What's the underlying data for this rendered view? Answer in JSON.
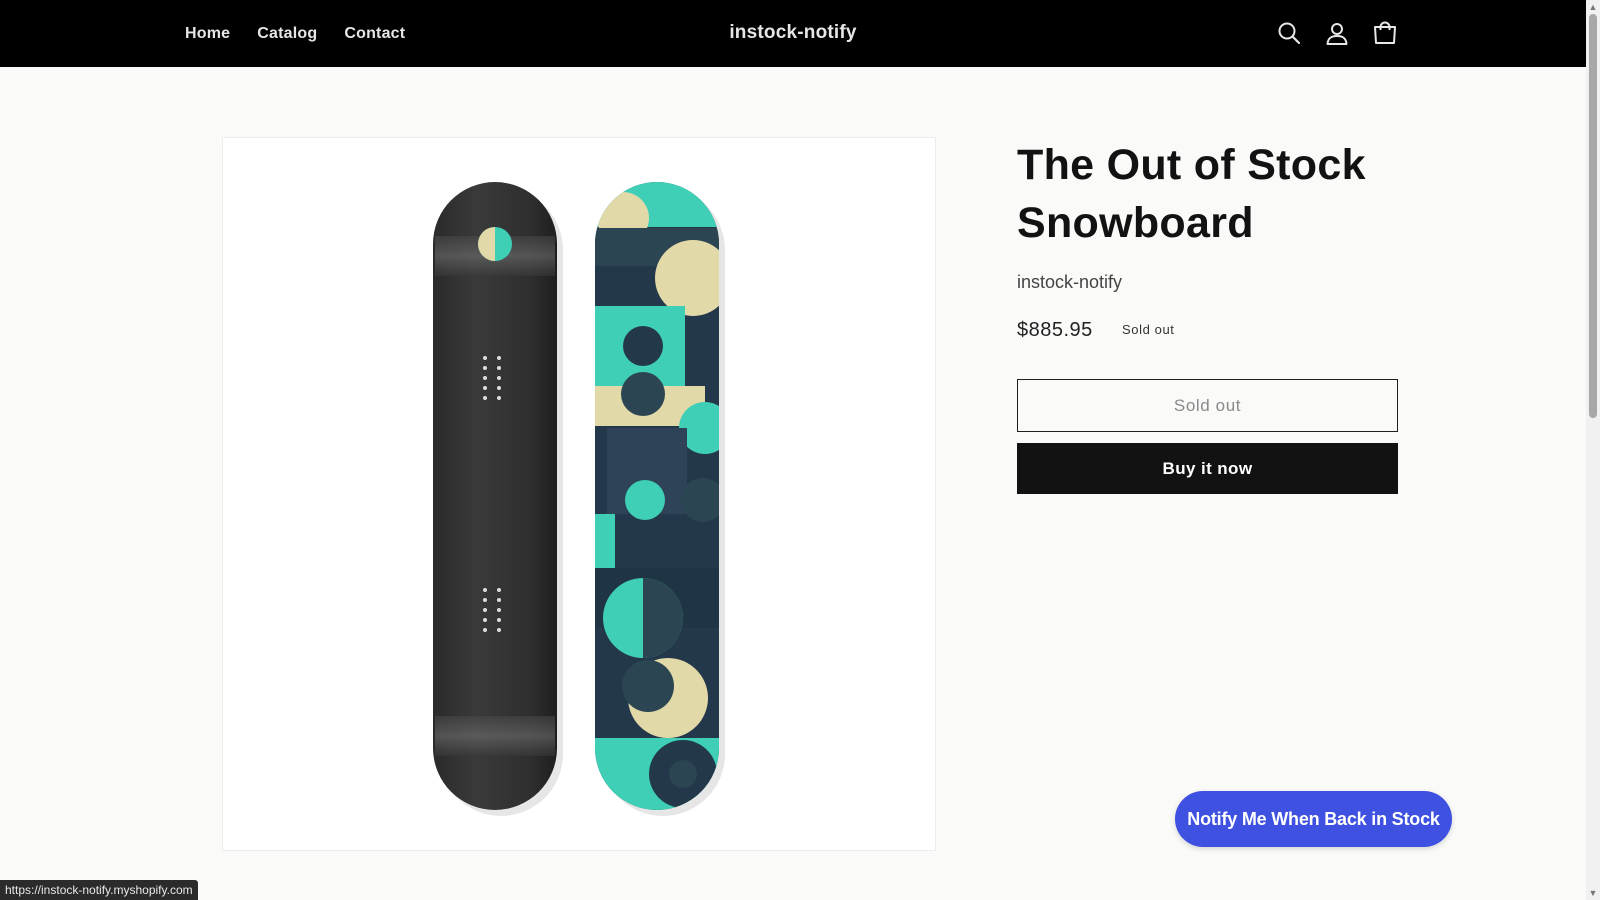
{
  "header": {
    "nav": [
      "Home",
      "Catalog",
      "Contact"
    ],
    "brand": "instock-notify",
    "icons": [
      "search-icon",
      "account-icon",
      "cart-icon"
    ]
  },
  "product": {
    "title": "The Out of Stock Snowboard",
    "vendor": "instock-notify",
    "price": "$885.95",
    "badge": "Sold out",
    "sold_out_button": "Sold out",
    "buy_now_button": "Buy it now",
    "image": "snowboard-image"
  },
  "notify_button": "Notify Me When Back in Stock",
  "status_url": "https://instock-notify.myshopify.com",
  "colors": {
    "header_bg": "#000000",
    "notify_blue": "#3f51e0",
    "board_teal": "#3ecfb6",
    "board_navy": "#23384a",
    "board_cream": "#e2d9a9"
  }
}
